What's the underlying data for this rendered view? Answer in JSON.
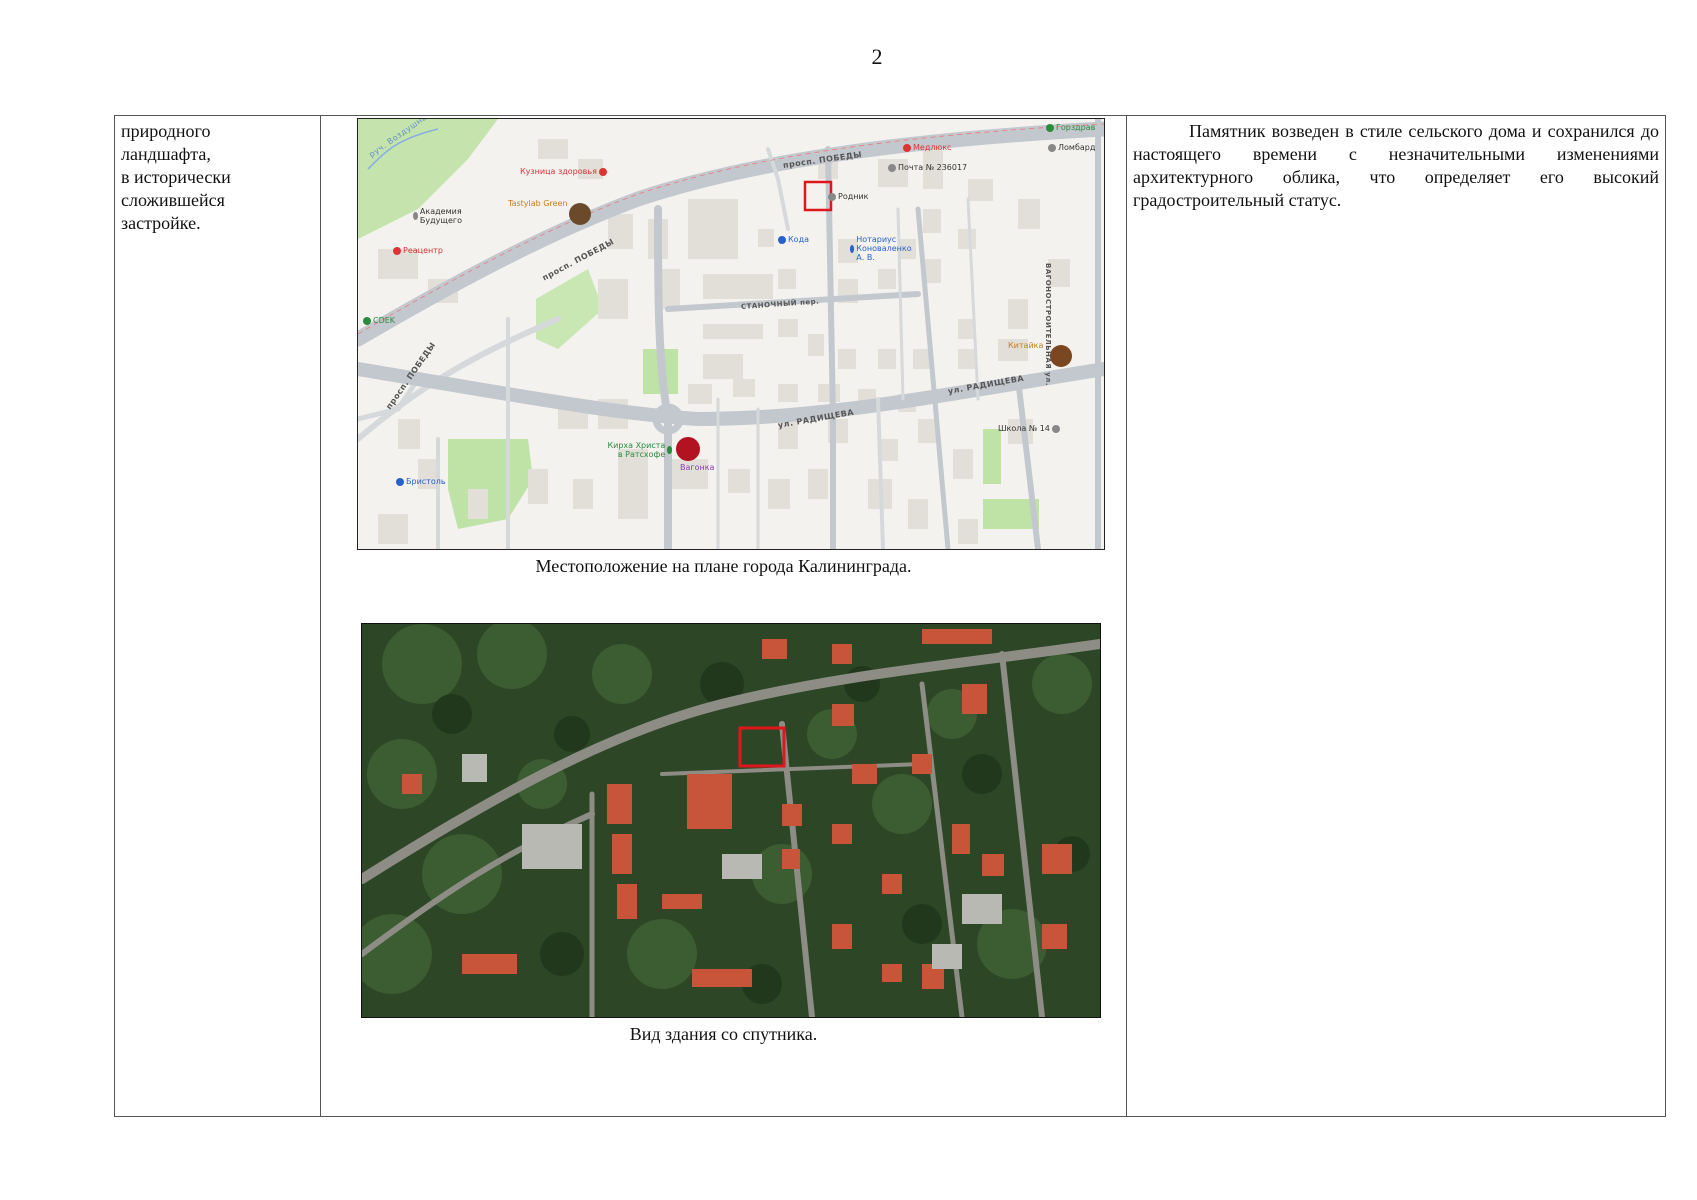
{
  "page": {
    "number": "2"
  },
  "row": {
    "left_lines": [
      "природного",
      "ландшафта,",
      "в исторически",
      "сложившейся",
      "застройке."
    ],
    "right_text": "Памятник возведен в стиле сельского дома и сохранился до настоящего времени с незначительными изменениями архитектурного облика, что определяет его высокий градостроительный статус."
  },
  "map": {
    "caption": "Местоположение на плане города Калининграда.",
    "streets": {
      "pobedy_top": "просп. ПОБЕДЫ",
      "pobedy_mid": "просп. ПОБЕДЫ",
      "pobedy_left": "просп. ПОБЕДЫ",
      "radishcheva_1": "ул. РАДИЩЕВА",
      "radishcheva_2": "ул. РАДИЩЕВА",
      "stanochny": "СТАНОЧНЫЙ пер.",
      "vagonostroitelnaya": "ВАГОНОСТРОИТЕЛЬНАЯ ул.",
      "vozdushny": "руч. Воздушный"
    },
    "pois": {
      "gorzdrav": "Горздрав",
      "lombard": "Ломбард",
      "medlux": "Медлюкс",
      "pochta": "Почта № 236017",
      "kuznitsa": "Кузница здоровья",
      "tastylab": "Tastylab Green",
      "akademia": "Академия Будущего",
      "reacentr": "Реацентр",
      "rodnik": "Родник",
      "koda": "Кода",
      "notarius": "Нотариус Коноваленко А. В.",
      "cdek": "CDEK",
      "kitaika": "Китайка",
      "shkola": "Школа № 14",
      "kirha": "Кирха Христа в Ратсхофе",
      "vagonka": "Вагонка",
      "bristol": "Бристоль"
    },
    "colors": {
      "road": "#c8cdd3",
      "block": "#e6e3dc",
      "park": "#bfe2a6",
      "highlight": "#e0161d"
    }
  },
  "satellite": {
    "caption": "Вид здания  со спутника.",
    "colors": {
      "roof": "#c8553a",
      "tree": "#2d4b26",
      "road": "#8f8f88",
      "highlight": "#e0161d"
    }
  }
}
